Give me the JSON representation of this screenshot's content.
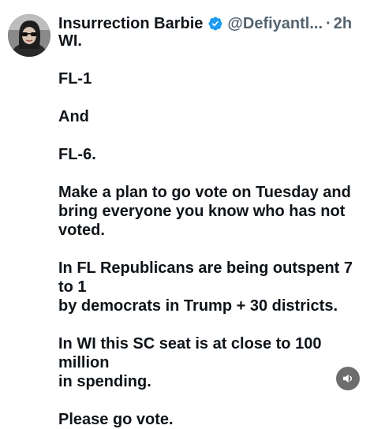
{
  "author": {
    "display_name": "Insurrection Barbie",
    "handle": "@Defiyantl...",
    "separator": "·",
    "time": "2h",
    "verified_color": "#1d9bf0"
  },
  "tweet": {
    "lines": [
      "WI.",
      "FL-1",
      "And",
      "FL-6.",
      "Make a plan to go vote on Tuesday and",
      "bring everyone you know who has not",
      "voted.",
      "In FL Republicans are being outspent 7 to 1",
      "by democrats in Trump + 30 districts.",
      "In WI this SC seat is at close to 100 million",
      "in spending.",
      "Please go vote."
    ]
  },
  "controls": {
    "sound_icon": "speaker-icon"
  }
}
